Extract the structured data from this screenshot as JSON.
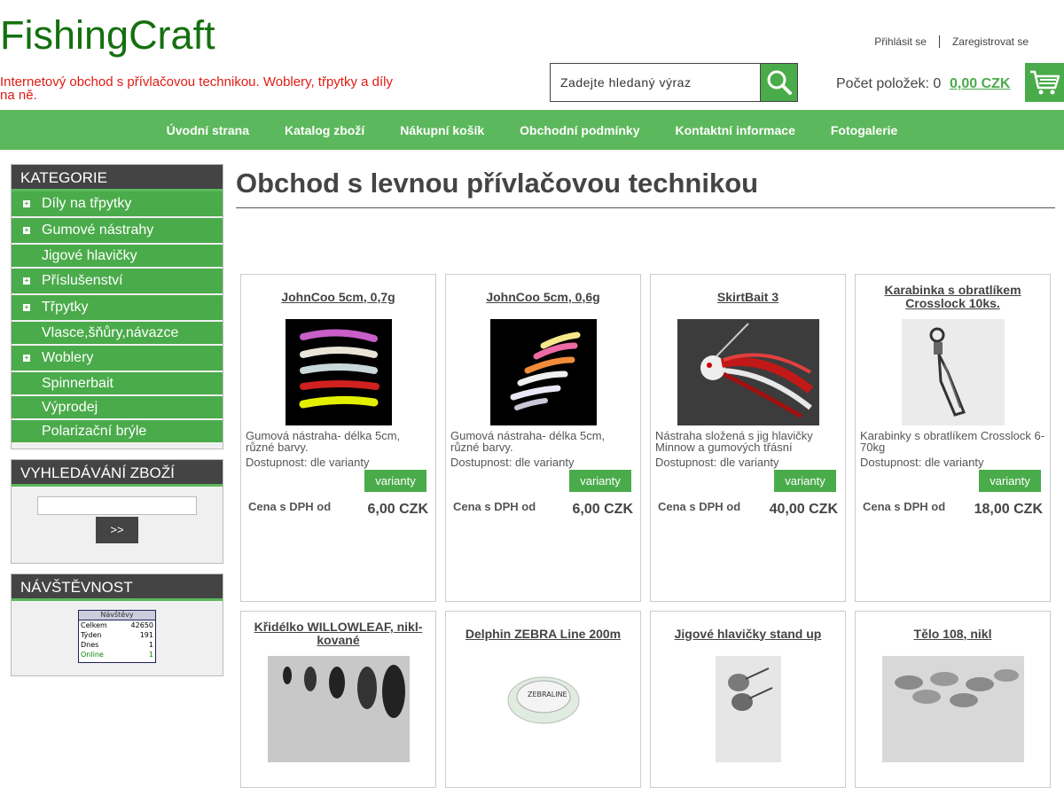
{
  "header": {
    "logo": "FishingCraft",
    "tagline": "Internetový obchod s přívlačovou technikou. Woblery, třpytky a díly na ně.",
    "login": "Přihlásit se",
    "register": "Zaregistrovat se",
    "search_placeholder": "Zadejte hledaný výraz",
    "cart_label": "Počet položek: 0",
    "cart_price": "0,00 CZK"
  },
  "nav": [
    "Úvodní strana",
    "Katalog zboží",
    "Nákupní košík",
    "Obchodní podmínky",
    "Kontaktní informace",
    "Fotogalerie"
  ],
  "sidebar": {
    "categories_title": "KATEGORIE",
    "categories": [
      {
        "label": "Díly na třpytky",
        "expandable": true
      },
      {
        "label": "Gumové nástrahy",
        "expandable": true
      },
      {
        "label": "Jigové hlavičky",
        "expandable": false
      },
      {
        "label": "Příslušenství",
        "expandable": true
      },
      {
        "label": "Třpytky",
        "expandable": true
      },
      {
        "label": "Vlasce,šňůry,návazce",
        "expandable": false
      },
      {
        "label": "Woblery",
        "expandable": true
      },
      {
        "label": "Spinnerbait",
        "expandable": false
      },
      {
        "label": "Výprodej",
        "expandable": false
      },
      {
        "label": "Polarizační brýle",
        "expandable": false
      }
    ],
    "search_title": "VYHLEDÁVÁNÍ ZBOŽÍ",
    "search_button": ">>",
    "visits_title": "NÁVŠTĚVNOST",
    "counter": {
      "title": "Návštěvy",
      "rows": [
        {
          "k": "Celkem",
          "v": "42650"
        },
        {
          "k": "Týden",
          "v": "191"
        },
        {
          "k": "Dnes",
          "v": "1"
        },
        {
          "k": "Online",
          "v": "1"
        }
      ]
    }
  },
  "main": {
    "title": "Obchod s levnou přívlačovou technikou",
    "products": [
      {
        "name": "JohnCoo 5cm, 0,7g",
        "desc": "Gumová nástraha- délka 5cm, různé barvy.",
        "avail": "Dostupnost: dle varianty",
        "button": "varianty",
        "price_label": "Cena s DPH od",
        "price": "6,00 CZK"
      },
      {
        "name": "JohnCoo 5cm, 0,6g",
        "desc": "Gumová nástraha- délka 5cm, různé barvy.",
        "avail": "Dostupnost: dle varianty",
        "button": "varianty",
        "price_label": "Cena s DPH od",
        "price": "6,00 CZK"
      },
      {
        "name": "SkirtBait 3",
        "desc": "Nástraha složená s jig hlavičky Minnow a gumových třásní",
        "avail": "Dostupnost: dle varianty",
        "button": "varianty",
        "price_label": "Cena s DPH od",
        "price": "40,00 CZK"
      },
      {
        "name": "Karabinka s obratlíkem Crosslock 10ks.",
        "desc": "Karabinky s obratlíkem Crosslock 6-70kg",
        "avail": "Dostupnost: dle varianty",
        "button": "varianty",
        "price_label": "Cena s DPH od",
        "price": "18,00 CZK"
      },
      {
        "name": "Křidélko WILLOWLEAF, nikl-kované"
      },
      {
        "name": "Delphin ZEBRA Line 200m"
      },
      {
        "name": "Jigové hlavičky stand up"
      },
      {
        "name": "Tělo 108, nikl"
      }
    ]
  }
}
